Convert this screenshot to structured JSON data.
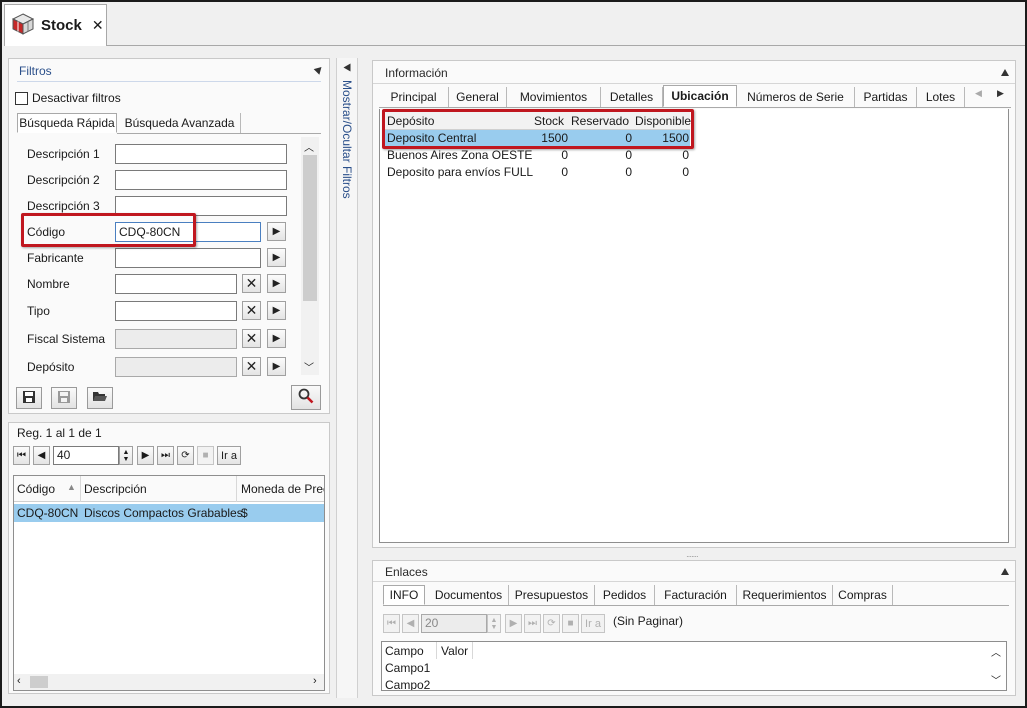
{
  "window": {
    "tab_title": "Stock",
    "close_glyph": "✕"
  },
  "filters": {
    "panel_title": "Filtros",
    "disable_label": "Desactivar filtros",
    "tabs": [
      "Búsqueda Rápida",
      "Búsqueda Avanzada"
    ],
    "fields": [
      {
        "label": "Descripción 1",
        "value": ""
      },
      {
        "label": "Descripción 2",
        "value": ""
      },
      {
        "label": "Descripción 3",
        "value": ""
      },
      {
        "label": "Código",
        "value": "CDQ-80CN"
      },
      {
        "label": "Fabricante",
        "value": ""
      },
      {
        "label": "Nombre",
        "value": ""
      },
      {
        "label": "Tipo",
        "value": ""
      },
      {
        "label": "Fiscal Sistema",
        "value": ""
      },
      {
        "label": "Depósito",
        "value": ""
      }
    ]
  },
  "results": {
    "record_info": "Reg. 1 al 1 de 1",
    "page_size": "40",
    "goto_label": "Ir a",
    "columns": [
      "Código",
      "Descripción",
      "Moneda de Precio"
    ],
    "rows": [
      {
        "codigo": "CDQ-80CN",
        "descripcion": "Discos Compactos Grabables",
        "moneda": "$"
      }
    ]
  },
  "toggle_filters_label": "Mostrar/Ocultar Filtros",
  "info": {
    "group_title": "Información",
    "tabs": [
      "Principal",
      "General",
      "Movimientos",
      "Detalles",
      "Ubicación",
      "Números de Serie",
      "Partidas",
      "Lotes"
    ],
    "active_tab": "Ubicación",
    "table": {
      "columns": [
        "Depósito",
        "Stock",
        "Reservado",
        "Disponible"
      ],
      "rows": [
        {
          "deposito": "Deposito Central",
          "stock": "1500",
          "reservado": "0",
          "disponible": "1500"
        },
        {
          "deposito": "Buenos Aires Zona OESTE",
          "stock": "0",
          "reservado": "0",
          "disponible": "0"
        },
        {
          "deposito": "Deposito para envíos FULL",
          "stock": "0",
          "reservado": "0",
          "disponible": "0"
        }
      ]
    }
  },
  "links": {
    "group_title": "Enlaces",
    "tabs": [
      "INFO",
      "Documentos",
      "Presupuestos",
      "Pedidos",
      "Facturación",
      "Requerimientos",
      "Compras"
    ],
    "page_size": "20",
    "goto_label": "Ir a",
    "paging_text": "(Sin Paginar)",
    "columns": [
      "Campo",
      "Valor"
    ],
    "rows": [
      "Campo1",
      "Campo2"
    ]
  },
  "colors": {
    "selection": "#99ccee",
    "highlight": "#c0171f",
    "link_title": "#2a4f8a"
  }
}
